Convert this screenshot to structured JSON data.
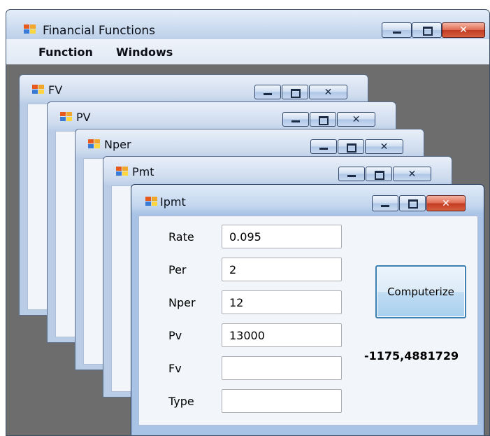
{
  "app": {
    "title": "Financial Functions"
  },
  "menu": {
    "items": [
      "Function",
      "Windows"
    ]
  },
  "children": {
    "fv": {
      "title": "FV"
    },
    "pv": {
      "title": "PV"
    },
    "nper": {
      "title": "Nper"
    },
    "pmt": {
      "title": "Pmt"
    },
    "ipmt": {
      "title": "Ipmt"
    }
  },
  "ipmt_form": {
    "fields": [
      {
        "label": "Rate",
        "value": "0.095"
      },
      {
        "label": "Per",
        "value": "2"
      },
      {
        "label": "Nper",
        "value": "12"
      },
      {
        "label": "Pv",
        "value": "13000"
      },
      {
        "label": "Fv",
        "value": ""
      },
      {
        "label": "Type",
        "value": ""
      }
    ],
    "compute_label": "Computerize",
    "result": "-1175,4881729"
  },
  "icons": {
    "app_icon": "mdi-form-icon",
    "minimize": "minimize-icon",
    "maximize": "maximize-icon",
    "close": "close-icon"
  },
  "colors": {
    "mdi_background": "#6d6d6d",
    "close_button": "#c23b22",
    "button_border": "#3c7fb1"
  }
}
